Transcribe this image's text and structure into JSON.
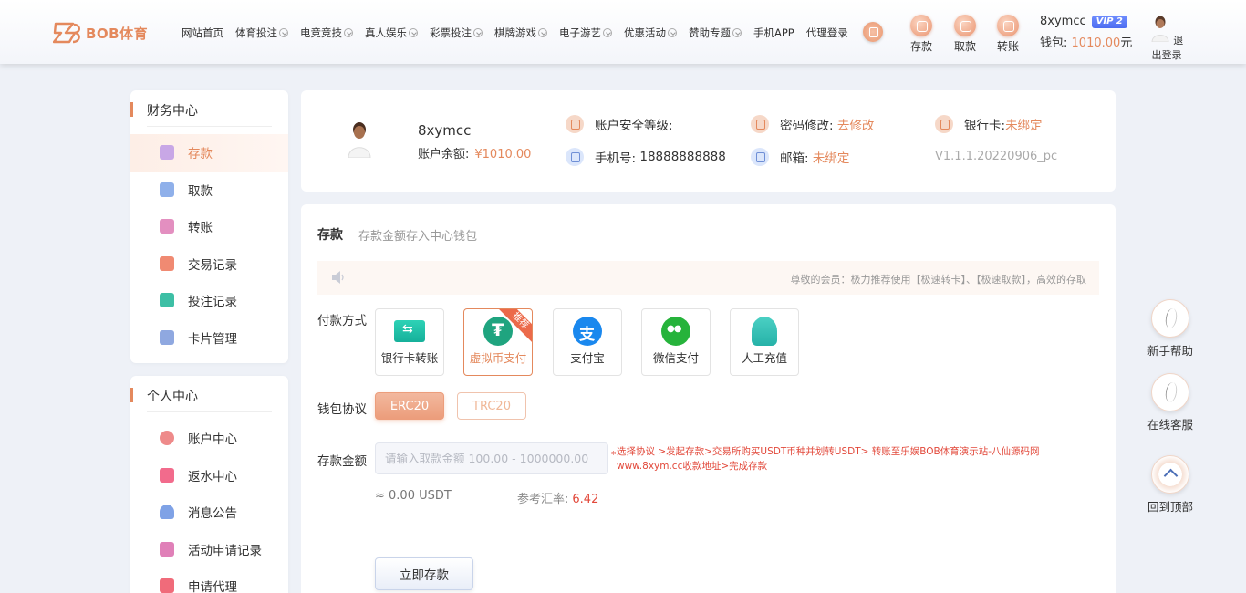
{
  "header": {
    "logo_text": "BOB体育",
    "nav": [
      {
        "label": "网站首页",
        "dropdown": false
      },
      {
        "label": "体育投注",
        "dropdown": true
      },
      {
        "label": "电竞竞技",
        "dropdown": true
      },
      {
        "label": "真人娱乐",
        "dropdown": true
      },
      {
        "label": "彩票投注",
        "dropdown": true
      },
      {
        "label": "棋牌游戏",
        "dropdown": true
      },
      {
        "label": "电子游艺",
        "dropdown": true
      },
      {
        "label": "优惠活动",
        "dropdown": true
      },
      {
        "label": "赞助专题",
        "dropdown": true
      },
      {
        "label": "手机APP",
        "dropdown": false
      },
      {
        "label": "代理登录",
        "dropdown": false
      }
    ],
    "quick": {
      "deposit": "存款",
      "withdraw": "取款",
      "transfer": "转账"
    },
    "user": {
      "name": "8xymcc",
      "vip": "VIP 2",
      "wallet_label": "钱包:",
      "wallet_amount": "1010.00",
      "wallet_unit": "元"
    },
    "logout": "退出登录"
  },
  "sidebar": {
    "finance": {
      "title": "财务中心",
      "items": [
        {
          "label": "存款",
          "icon": "deposit-icon",
          "color": "#c8a7e6"
        },
        {
          "label": "取款",
          "icon": "wallet-icon",
          "color": "#8fb0ea"
        },
        {
          "label": "转账",
          "icon": "transfer-icon",
          "color": "#e38fc0"
        },
        {
          "label": "交易记录",
          "icon": "record-icon",
          "color": "#f08a72"
        },
        {
          "label": "投注记录",
          "icon": "bet-record-icon",
          "color": "#3dbfa5"
        },
        {
          "label": "卡片管理",
          "icon": "card-icon",
          "color": "#8fa8e0"
        }
      ]
    },
    "personal": {
      "title": "个人中心",
      "items": [
        {
          "label": "账户中心",
          "icon": "heart-icon",
          "color": "#ee8a8a"
        },
        {
          "label": "返水中心",
          "icon": "gift-icon",
          "color": "#f26b8c"
        },
        {
          "label": "消息公告",
          "icon": "bell-icon",
          "color": "#7fa2e6"
        },
        {
          "label": "活动申请记录",
          "icon": "activity-icon",
          "color": "#e080b8"
        },
        {
          "label": "申请代理",
          "icon": "agent-icon",
          "color": "#f06b7a"
        }
      ]
    }
  },
  "profile": {
    "username": "8xymcc",
    "balance_label": "账户余额:",
    "balance_value": "¥1010.00",
    "security_label": "账户安全等级:",
    "phone_label": "手机号:",
    "phone_value": "18888888888",
    "password_label": "密码修改:",
    "password_action": "去修改",
    "email_label": "邮箱:",
    "email_value": "未绑定",
    "bankcard_label": "银行卡:",
    "bankcard_value": "未绑定",
    "version": "V1.1.1.20220906_pc"
  },
  "deposit": {
    "title": "存款",
    "subtitle": "存款金额存入中心钱包",
    "notice": "尊敬的会员：极力推荐使用【极速转卡】、【极速取款】，高效的存取",
    "method_label": "付款方式",
    "methods": [
      {
        "label": "银行卡转账",
        "icon": "bank-transfer-icon",
        "selected": false
      },
      {
        "label": "虚拟币支付",
        "icon": "usdt-icon",
        "selected": true,
        "badge": "推荐"
      },
      {
        "label": "支付宝",
        "icon": "alipay-icon",
        "selected": false
      },
      {
        "label": "微信支付",
        "icon": "wechat-icon",
        "selected": false
      },
      {
        "label": "人工充值",
        "icon": "manual-recharge-icon",
        "selected": false
      }
    ],
    "protocol_label": "钱包协议",
    "protocols": [
      {
        "label": "ERC20",
        "selected": true
      },
      {
        "label": "TRC20",
        "selected": false
      }
    ],
    "amount_label": "存款金额",
    "amount_placeholder": "请输入取款金额 100.00 - 1000000.00",
    "hint_star": "*",
    "hint_line1": "选择协议 >发起存款>交易所购买USDT币种并划转USDT> 转账至乐娱BOB体育演示站-八仙源码网",
    "hint_line2": "www.8xym.cc收款地址>完成存款",
    "usdt_estimate": "≈ 0.00 USDT",
    "rate_label": "参考汇率:",
    "rate_value": "6.42",
    "submit": "立即存款"
  },
  "floating": {
    "help": "新手帮助",
    "service": "在线客服",
    "top": "回到顶部"
  }
}
